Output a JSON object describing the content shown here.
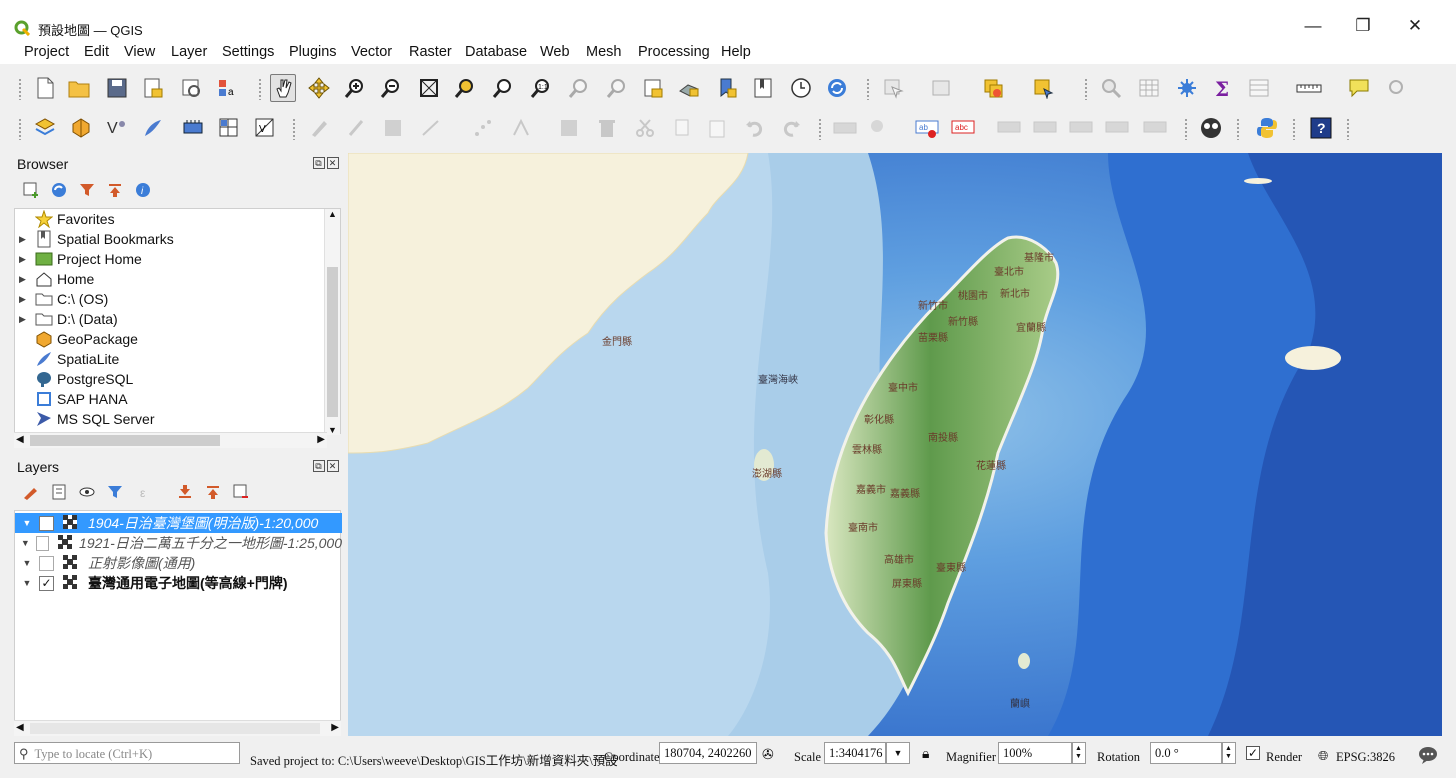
{
  "window": {
    "title": "預設地圖 — QGIS",
    "minimize": "—",
    "restore": "❐",
    "close": "✕"
  },
  "menu": [
    "Project",
    "Edit",
    "View",
    "Layer",
    "Settings",
    "Plugins",
    "Vector",
    "Raster",
    "Database",
    "Web",
    "Mesh",
    "Processing",
    "Help"
  ],
  "browser": {
    "title": "Browser",
    "items": [
      {
        "label": "Favorites",
        "icon": "star-icon",
        "expandable": false
      },
      {
        "label": "Spatial Bookmarks",
        "icon": "bookmark-icon",
        "expandable": true
      },
      {
        "label": "Project Home",
        "icon": "project-home-icon",
        "expandable": true
      },
      {
        "label": "Home",
        "icon": "home-icon",
        "expandable": true
      },
      {
        "label": "C:\\ (OS)",
        "icon": "folder-icon",
        "expandable": true
      },
      {
        "label": "D:\\ (Data)",
        "icon": "folder-icon",
        "expandable": true
      },
      {
        "label": "GeoPackage",
        "icon": "geopackage-icon",
        "expandable": false
      },
      {
        "label": "SpatiaLite",
        "icon": "spatialite-icon",
        "expandable": false
      },
      {
        "label": "PostgreSQL",
        "icon": "postgresql-icon",
        "expandable": false
      },
      {
        "label": "SAP HANA",
        "icon": "sap-hana-icon",
        "expandable": false
      },
      {
        "label": "MS SQL Server",
        "icon": "mssql-icon",
        "expandable": false
      }
    ]
  },
  "layers": {
    "title": "Layers",
    "items": [
      {
        "label": "1904-日治臺灣堡圖(明治版)-1:20,000",
        "checked": false,
        "selected": true,
        "italic": true
      },
      {
        "label": "1921-日治二萬五千分之一地形圖-1:25,000",
        "checked": false,
        "selected": false,
        "italic": true
      },
      {
        "label": "正射影像圖(通用)",
        "checked": false,
        "selected": false,
        "italic": true
      },
      {
        "label": "臺灣通用電子地圖(等高線+門牌)",
        "checked": true,
        "selected": false,
        "italic": false
      }
    ]
  },
  "map": {
    "labels": {
      "taiwan_strait": "臺灣海峽",
      "kinmen": "金門縣",
      "penghu": "澎湖縣",
      "keelung": "基隆市",
      "taipei": "臺北市",
      "new_taipei": "新北市",
      "taoyuan": "桃園市",
      "hsinchu_city": "新竹市",
      "hsinchu_county": "新竹縣",
      "yilan": "宜蘭縣",
      "miaoli": "苗栗縣",
      "taichung": "臺中市",
      "changhua": "彰化縣",
      "nantou": "南投縣",
      "yunlin": "雲林縣",
      "chiayi_city": "嘉義市",
      "chiayi_county": "嘉義縣",
      "hualien": "花蓮縣",
      "tainan": "臺南市",
      "kaohsiung": "高雄市",
      "pingtung": "屏東縣",
      "taitung": "臺東縣",
      "lanyu": "蘭嶼"
    }
  },
  "status": {
    "locate_placeholder": "Type to locate (Ctrl+K)",
    "message": "Saved project to: C:\\Users\\weeve\\Desktop\\GIS工作坊\\新增資料夾\\預設",
    "coordinate_label": "Coordinate",
    "coordinate_value": "180704, 2402260",
    "scale_label": "Scale",
    "scale_value": "1:3404176",
    "magnifier_label": "Magnifier",
    "magnifier_value": "100%",
    "rotation_label": "Rotation",
    "rotation_value": "0.0 °",
    "render_label": "Render",
    "crs": "EPSG:3826"
  },
  "colors": {
    "accent": "#3399ff",
    "sea_deep": "#2f6fd0",
    "sea_shallow": "#a9cde9",
    "land_mainland": "#f6f1dc",
    "mountains": "#5f9a4c"
  }
}
